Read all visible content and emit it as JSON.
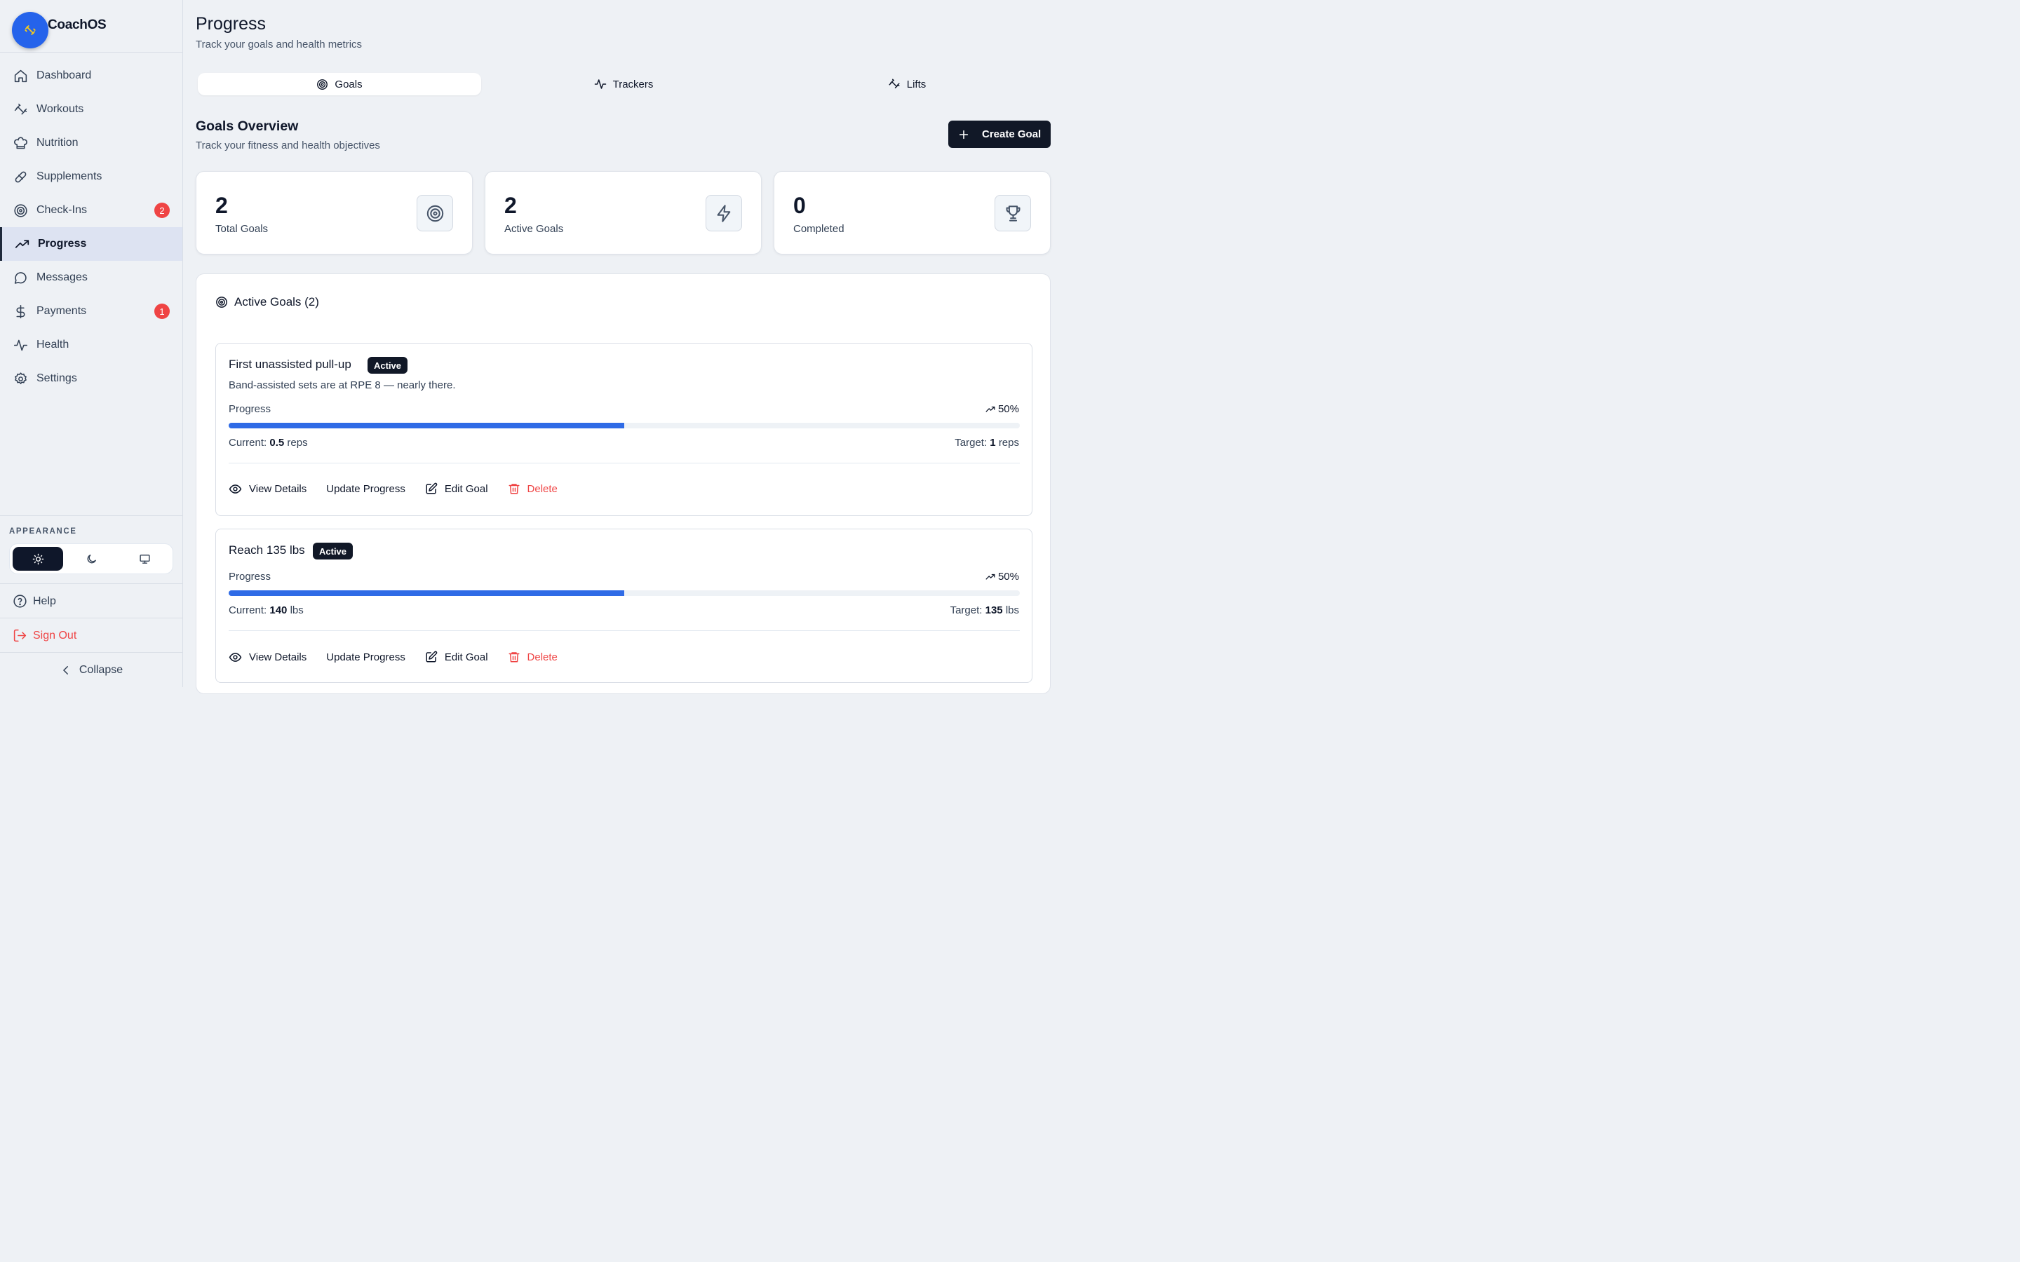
{
  "brand": {
    "name": "CoachOS"
  },
  "sidebar": {
    "items": [
      {
        "label": "Dashboard",
        "icon": "home-icon"
      },
      {
        "label": "Workouts",
        "icon": "dumbbell-icon"
      },
      {
        "label": "Nutrition",
        "icon": "chef-hat-icon"
      },
      {
        "label": "Supplements",
        "icon": "pill-icon"
      },
      {
        "label": "Check-Ins",
        "icon": "target-icon",
        "badge": "2"
      },
      {
        "label": "Progress",
        "icon": "trending-up-icon",
        "active": true
      },
      {
        "label": "Messages",
        "icon": "message-icon"
      },
      {
        "label": "Payments",
        "icon": "dollar-icon",
        "badge": "1"
      },
      {
        "label": "Health",
        "icon": "activity-icon"
      },
      {
        "label": "Settings",
        "icon": "gear-icon"
      }
    ],
    "appearance_label": "APPEARANCE",
    "theme_selected": "light",
    "help_label": "Help",
    "signout_label": "Sign Out",
    "collapse_label": "Collapse"
  },
  "header": {
    "title": "Progress",
    "subtitle": "Track your goals and health metrics"
  },
  "tabs": [
    {
      "label": "Goals",
      "icon": "target-icon",
      "selected": true
    },
    {
      "label": "Trackers",
      "icon": "activity-icon"
    },
    {
      "label": "Lifts",
      "icon": "dumbbell-icon"
    }
  ],
  "overview": {
    "title": "Goals Overview",
    "subtitle": "Track your fitness and health objectives",
    "create_label": "Create Goal"
  },
  "stats": [
    {
      "value": "2",
      "label": "Total Goals",
      "icon": "target-icon"
    },
    {
      "value": "2",
      "label": "Active Goals",
      "icon": "zap-icon"
    },
    {
      "value": "0",
      "label": "Completed",
      "icon": "trophy-icon"
    }
  ],
  "active_goals": {
    "header": "Active Goals (2)",
    "goals": [
      {
        "title": "First unassisted pull-up",
        "badge": "Active",
        "description": "Band-assisted sets are at RPE 8 — nearly there.",
        "progress_label": "Progress",
        "percent_text": "50%",
        "percent": 50,
        "current_label": "Current:",
        "current_value": "0.5",
        "current_unit": "reps",
        "target_label": "Target:",
        "target_value": "1",
        "target_unit": "reps"
      },
      {
        "title": "Reach 135 lbs",
        "badge": "Active",
        "description": "",
        "progress_label": "Progress",
        "percent_text": "50%",
        "percent": 50,
        "current_label": "Current:",
        "current_value": "140",
        "current_unit": "lbs",
        "target_label": "Target:",
        "target_value": "135",
        "target_unit": "lbs"
      }
    ],
    "actions": {
      "view": "View Details",
      "update": "Update Progress",
      "edit": "Edit Goal",
      "delete": "Delete"
    }
  },
  "colors": {
    "accent": "#2f6be6",
    "brand": "#2563eb",
    "danger": "#ef4444",
    "dark": "#111827"
  }
}
